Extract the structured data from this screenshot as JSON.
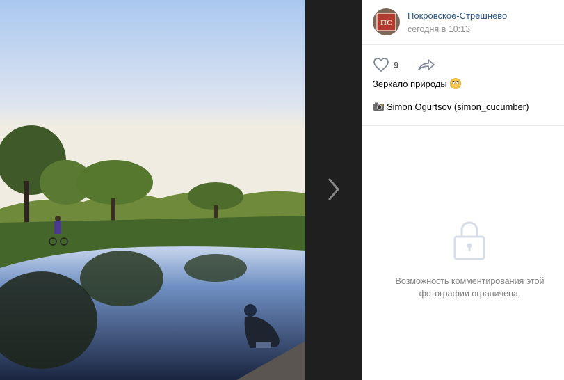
{
  "post": {
    "author": "Покровское-Стрешнево",
    "date": "сегодня в 10:13",
    "likes": "9",
    "caption": "Зеркало природы",
    "credit": "Simon Ogurtsov (simon_cucumber)"
  },
  "comments": {
    "disabled_text": "Возможность комментирования этой фотографии ограничена."
  },
  "avatar": {
    "initials": "ПС",
    "color": "#b33a2e"
  },
  "icons": {
    "like": "heart-icon",
    "share": "share-arrow-icon",
    "next": "chevron-right-icon",
    "lock": "lock-icon",
    "camera": "camera-emoji-icon",
    "emoji": "rolling-eyes-emoji-icon"
  },
  "colors": {
    "link": "#2a5885",
    "muted": "#939393",
    "viewer_bg": "#1f1f1f"
  }
}
